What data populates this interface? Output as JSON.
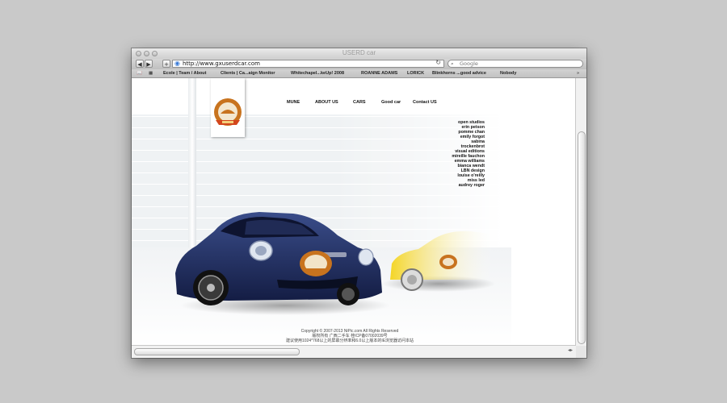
{
  "window": {
    "title": "USERD car"
  },
  "toolbar": {
    "back_label": "◀",
    "forward_label": "▶",
    "add_label": "+",
    "url": "http://www.gxuserdcar.com",
    "search_placeholder": "Google"
  },
  "bookmarks": [
    "Ecole | Team / About",
    "Clients | Ca...aign Monitor",
    "Whitechapel...keUp! 2008",
    "ROANNE ADAMS",
    "LORICK",
    "Blinkhorns ...good advice",
    "Nobody"
  ],
  "site": {
    "menu": [
      "MUNE",
      "ABOUT US",
      "CARS",
      "Good car",
      "Contact  US"
    ],
    "names": [
      "open studios",
      "erin petson",
      "pomme chan",
      "emily forgot",
      "sabina",
      "trockenbrot",
      "visual editions",
      "mireille fauchon",
      "emma williams",
      "bianca wendt",
      "LBN design",
      "louise o'reilly",
      "miss led",
      "audrey roger"
    ],
    "footer": [
      "Copyright © 2007-2013 NiPic.com All Rights Reserved",
      "版权所有 广西二手车 桂ICP备07002039号",
      "建议使用1024*768以上的屏幕分辨率和6.0以上版本的IE浏览器访问本站"
    ]
  },
  "colors": {
    "car_main": "#1e2a5c",
    "car_secondary": "#f2d21a",
    "logo_ring": "#c8731e",
    "accent_link": "#3b7bd6"
  }
}
